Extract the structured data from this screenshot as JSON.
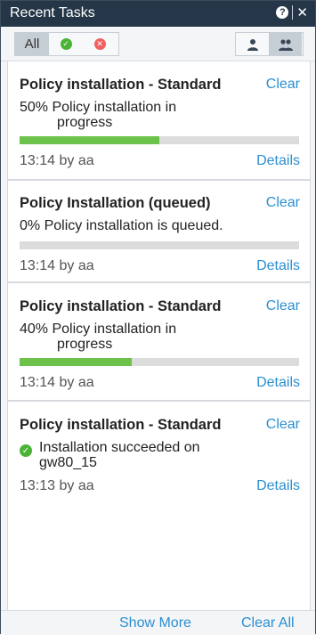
{
  "panel": {
    "title": "Recent Tasks"
  },
  "titlebar_icons": {
    "help": "?",
    "close": "✕"
  },
  "filters": {
    "all_label": "All",
    "success_icon": "check-circle-icon",
    "error_icon": "x-circle-icon"
  },
  "view_toggle": {
    "single_user_icon": "user-icon",
    "multi_user_icon": "users-icon",
    "selected": "users-icon"
  },
  "tasks": [
    {
      "title": "Policy installation - Standard",
      "clear_label": "Clear",
      "message_line1": "50% Policy installation in",
      "message_line2": "progress",
      "progress": 0.5,
      "meta": "13:14 by aa",
      "details_label": "Details"
    },
    {
      "title": "Policy Installation (queued)",
      "clear_label": "Clear",
      "message_line1": "0% Policy installation is queued.",
      "progress": 0,
      "meta": "13:14 by aa",
      "details_label": "Details"
    },
    {
      "title": "Policy installation - Standard",
      "clear_label": "Clear",
      "message_line1": "40% Policy installation in",
      "message_line2": "progress",
      "progress": 0.4,
      "meta": "13:14 by aa",
      "details_label": "Details"
    },
    {
      "title": "Policy installation - Standard",
      "clear_label": "Clear",
      "message_line1": "Installation succeeded on",
      "message_line2": "gw80_15",
      "status_icon": "check-circle-icon",
      "meta": "13:13 by aa",
      "details_label": "Details"
    }
  ],
  "footer": {
    "show_more": "Show More",
    "clear_all": "Clear All"
  },
  "colors": {
    "titlebar": "#243647",
    "link": "#2b8fd1",
    "progress_fill": "#6cc24a",
    "success": "#49b335",
    "error": "#f06060"
  }
}
